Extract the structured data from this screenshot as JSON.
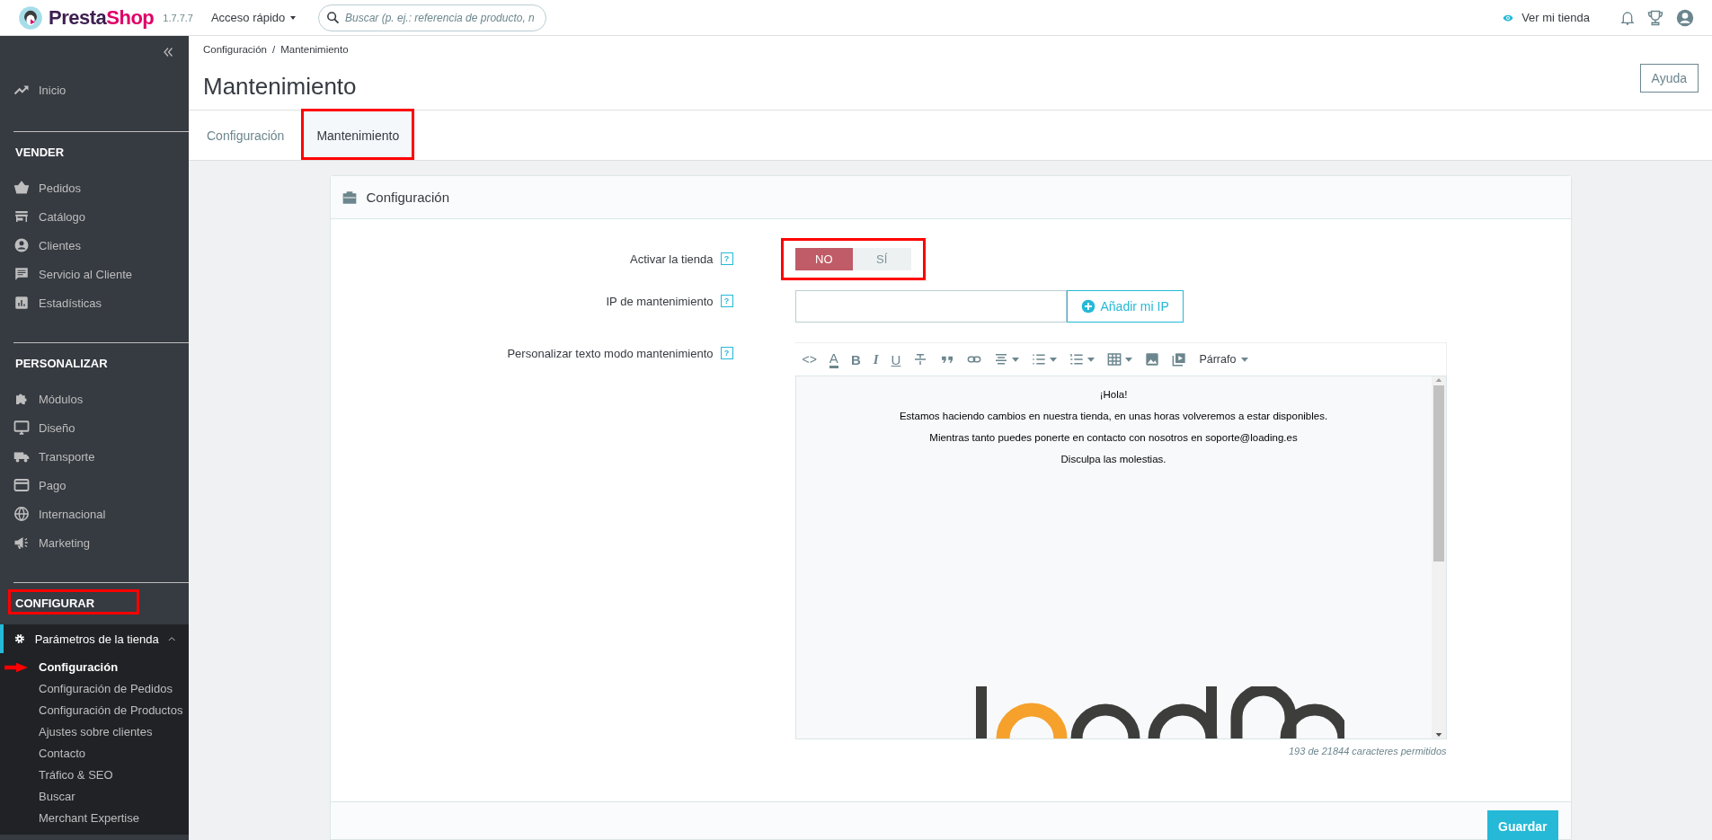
{
  "topbar": {
    "logo_parts": [
      "Presta",
      "Shop"
    ],
    "version": "1.7.7.7",
    "quick_access": "Acceso rápido",
    "search": {
      "placeholder": "Buscar (p. ej.: referencia de producto, n"
    },
    "view_store": "Ver mi tienda"
  },
  "sidebar": {
    "home": {
      "label": "Inicio"
    },
    "sections": [
      {
        "title": "VENDER",
        "highlighted": false,
        "items": [
          {
            "label": "Pedidos"
          },
          {
            "label": "Catálogo"
          },
          {
            "label": "Clientes"
          },
          {
            "label": "Servicio al Cliente"
          },
          {
            "label": "Estadísticas"
          }
        ]
      },
      {
        "title": "PERSONALIZAR",
        "highlighted": false,
        "items": [
          {
            "label": "Módulos"
          },
          {
            "label": "Diseño"
          },
          {
            "label": "Transporte"
          },
          {
            "label": "Pago"
          },
          {
            "label": "Internacional"
          },
          {
            "label": "Marketing"
          }
        ]
      },
      {
        "title": "CONFIGURAR",
        "highlighted": true,
        "items": [
          {
            "label": "Parámetros de la tienda",
            "expanded": true,
            "children": [
              {
                "label": "Configuración",
                "selected": true,
                "pointed": true
              },
              {
                "label": "Configuración de Pedidos",
                "selected": false,
                "pointed": false
              },
              {
                "label": "Configuración de Productos",
                "selected": false,
                "pointed": false
              },
              {
                "label": "Ajustes sobre clientes",
                "selected": false,
                "pointed": false
              },
              {
                "label": "Contacto",
                "selected": false,
                "pointed": false
              },
              {
                "label": "Tráfico & SEO",
                "selected": false,
                "pointed": false
              },
              {
                "label": "Buscar",
                "selected": false,
                "pointed": false
              },
              {
                "label": "Merchant Expertise",
                "selected": false,
                "pointed": false
              }
            ]
          }
        ]
      }
    ]
  },
  "header": {
    "breadcrumb": [
      "Configuración",
      "Mantenimiento"
    ],
    "breadcrumb_separator": "/",
    "title": "Mantenimiento",
    "help_button": "Ayuda"
  },
  "tabs": [
    {
      "label": "Configuración",
      "selected": false,
      "highlighted": false
    },
    {
      "label": "Mantenimiento",
      "selected": true,
      "highlighted": true
    }
  ],
  "panel": {
    "title": "Configuración",
    "fields": [
      {
        "kind": "toggle",
        "label": "Activar la tienda",
        "help": "?",
        "highlighted": true,
        "options": [
          {
            "label": "NO",
            "selected": true
          },
          {
            "label": "SÍ",
            "selected": false
          }
        ]
      },
      {
        "kind": "ip",
        "label": "IP de mantenimiento",
        "help": "?",
        "button": "Añadir mi IP"
      },
      {
        "kind": "editor",
        "label": "Personalizar texto modo mantenimiento",
        "help": "?",
        "toolbar": {
          "glyph_buttons": [
            {
              "kind": "code",
              "glyph": "<>"
            },
            {
              "kind": "color",
              "glyph": "A"
            },
            {
              "kind": "bold",
              "glyph": "B"
            },
            {
              "kind": "italic",
              "glyph": "I"
            },
            {
              "kind": "underline",
              "glyph": "U"
            }
          ],
          "format_menu": "Párrafo"
        },
        "paragraphs": [
          "¡Hola!",
          "Estamos haciendo cambios en nuestra tienda, en unas horas volveremos a estar disponibles.",
          "Mientras tanto puedes ponerte en contacto con nosotros en soporte@loading.es",
          "Disculpa las molestias."
        ],
        "counter": "193 de 21844 caracteres permitidos"
      }
    ],
    "save_button": "Guardar"
  }
}
